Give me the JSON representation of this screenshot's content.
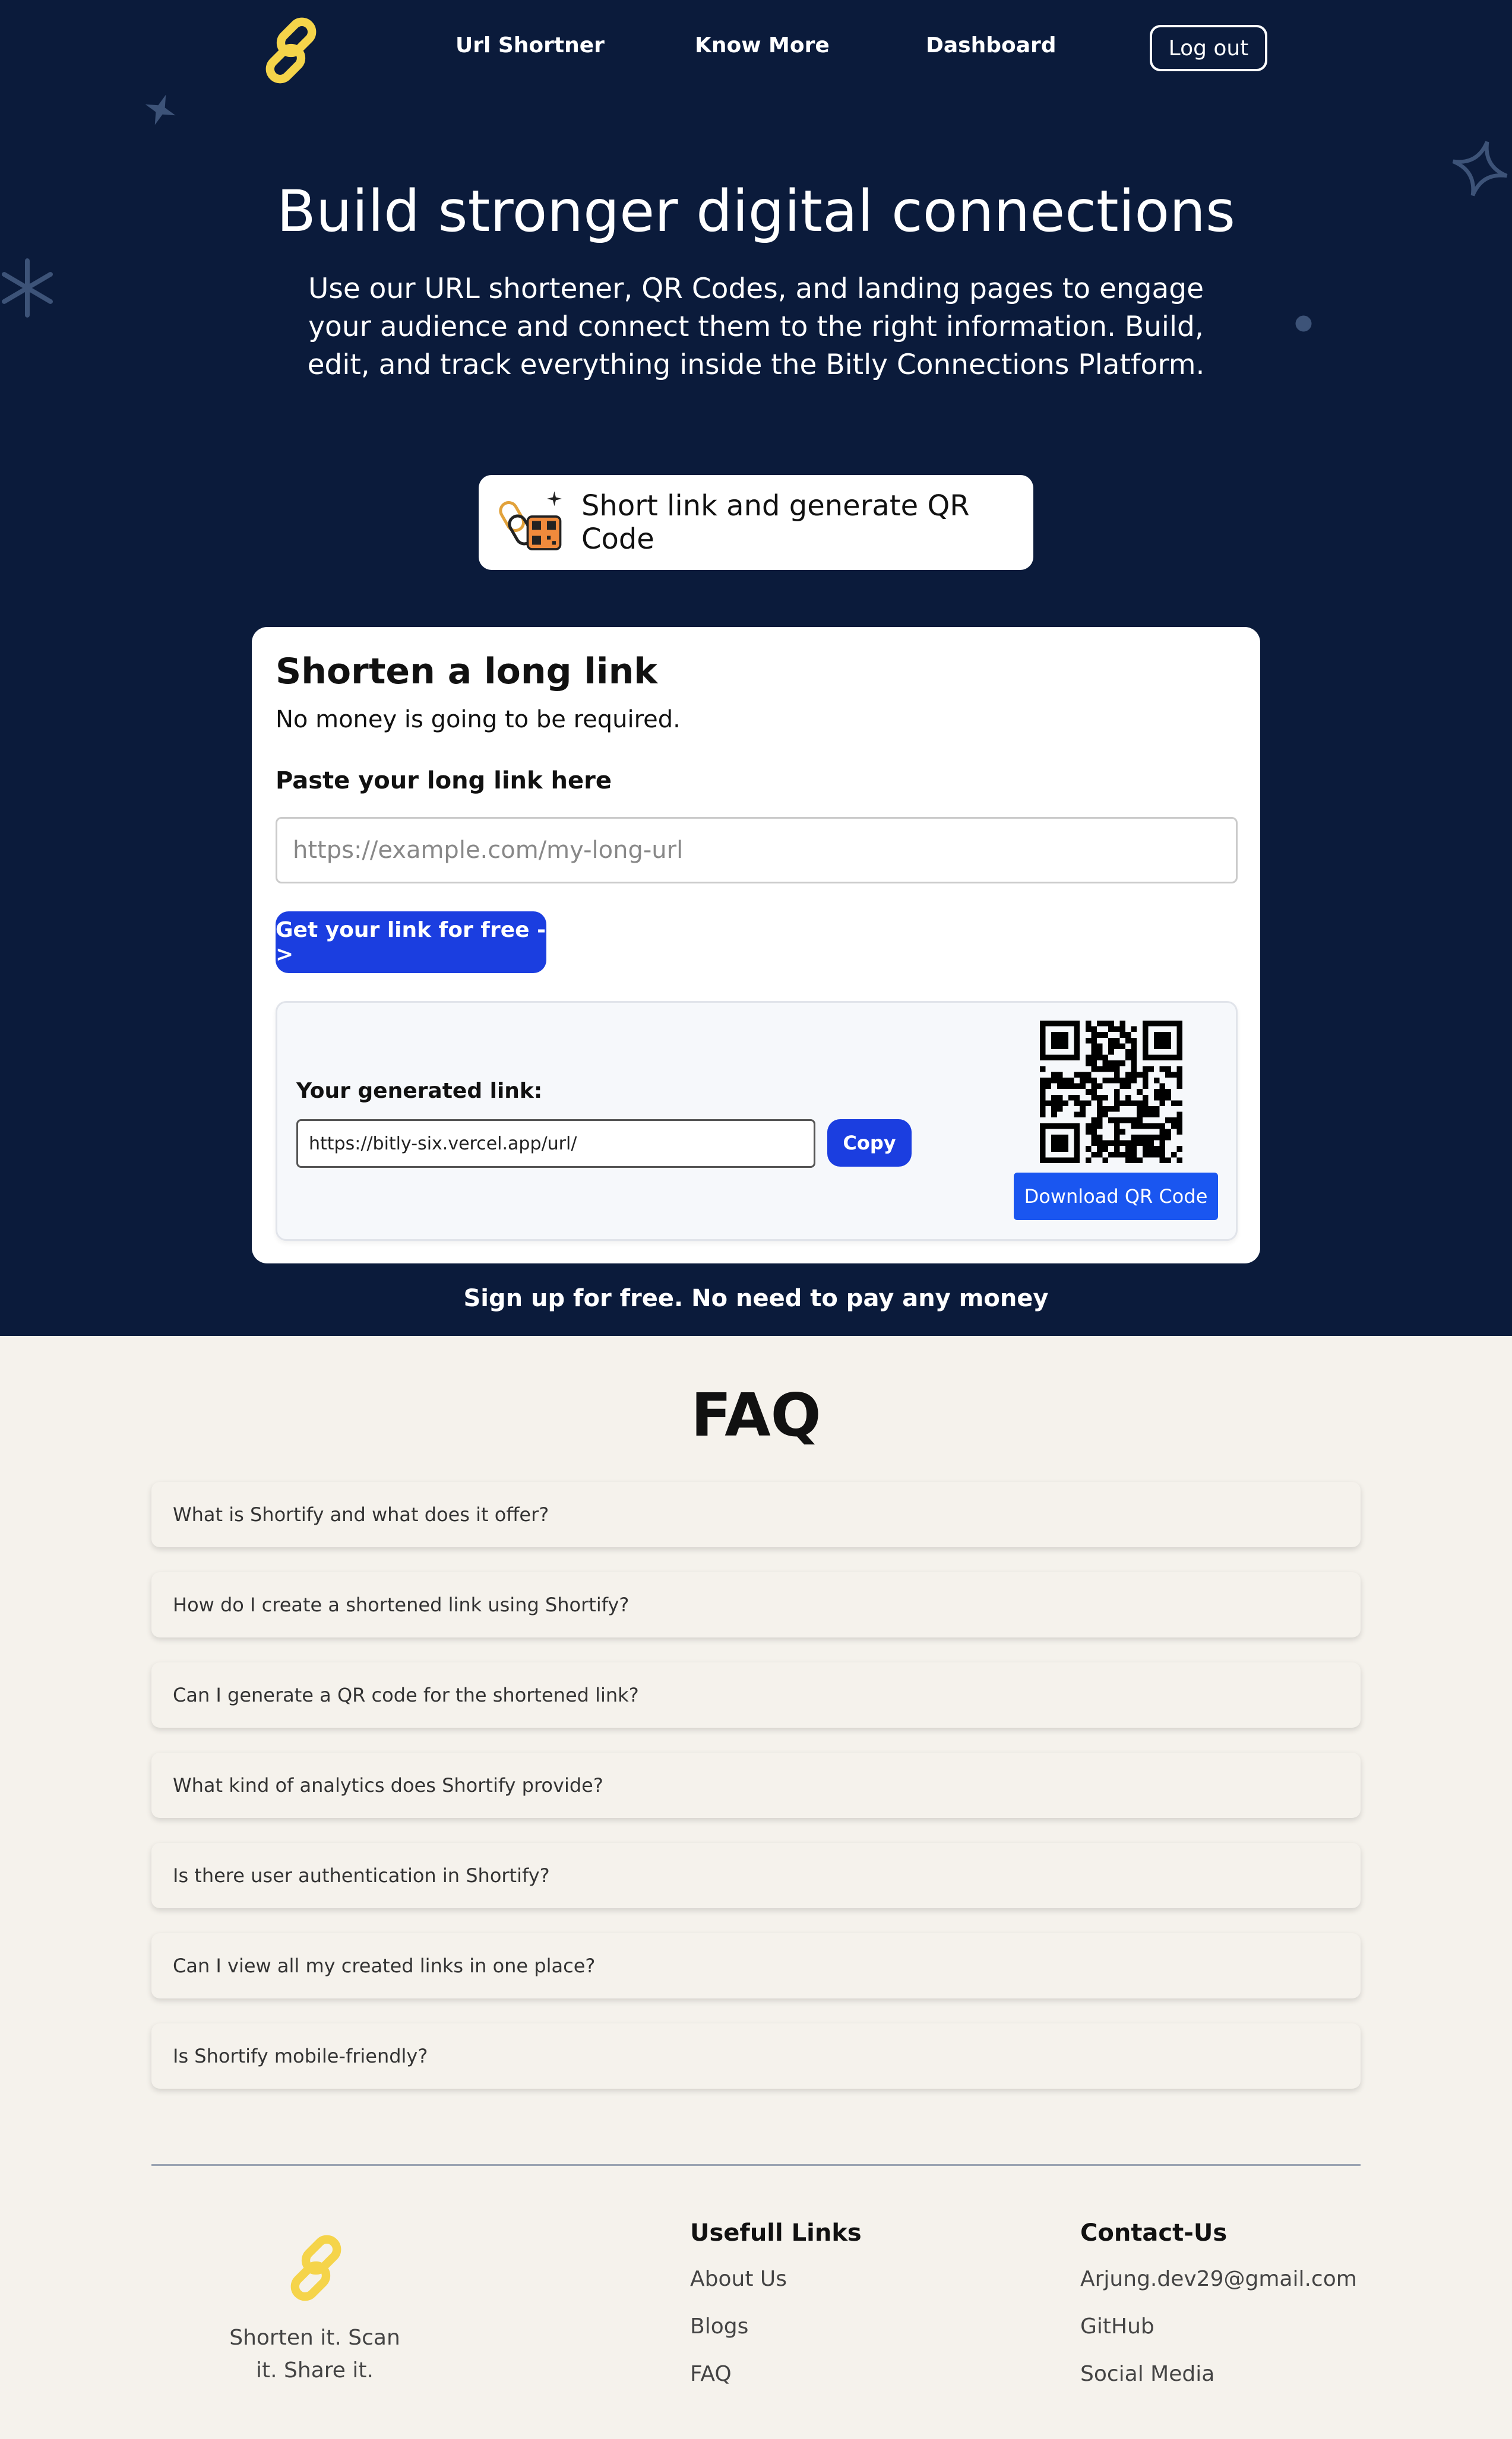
{
  "nav": {
    "links": [
      "Url Shortner",
      "Know More",
      "Dashboard"
    ],
    "logout_label": "Log out"
  },
  "hero": {
    "title": "Build stronger digital connections",
    "subtitle": "Use our URL shortener, QR Codes, and landing pages to engage your audience and connect them to the right information. Build, edit, and track everything inside the Bitly Connections Platform."
  },
  "feature_button": {
    "label": "Short link and generate QR Code"
  },
  "shortener": {
    "title": "Shorten a long link",
    "subtitle": "No money is going to be required.",
    "input_label": "Paste your long link here",
    "input_placeholder": "https://example.com/my-long-url",
    "submit_label": "Get your link for free ->",
    "result": {
      "label": "Your generated link:",
      "link_value": "https://bitly-six.vercel.app/url/",
      "copy_label": "Copy",
      "download_label": "Download QR Code"
    }
  },
  "signup_text": "Sign up for free. No need to pay any money",
  "faq": {
    "title": "FAQ",
    "items": [
      "What is Shortify and what does it offer?",
      "How do I create a shortened link using Shortify?",
      "Can I generate a QR code for the shortened link?",
      "What kind of analytics does Shortify provide?",
      "Is there user authentication in Shortify?",
      "Can I view all my created links in one place?",
      "Is Shortify mobile-friendly?"
    ]
  },
  "footer": {
    "tagline": "Shorten it. Scan it. Share it.",
    "links_heading": "Usefull Links",
    "links": [
      "About Us",
      "Blogs",
      "FAQ"
    ],
    "contact_heading": "Contact-Us",
    "contact": [
      "Arjung.dev29@gmail.com",
      "GitHub",
      "Social Media"
    ]
  },
  "colors": {
    "hero_bg": "#0b1b3b",
    "primary_button": "#1b3ee0",
    "download_button": "#1a56f0",
    "page_bg": "#f5f2ec",
    "logo": "#f5d44a"
  },
  "icons": [
    "chain-link-logo-icon",
    "sparkle-star-icon",
    "link-qr-feature-icon",
    "qr-code"
  ]
}
